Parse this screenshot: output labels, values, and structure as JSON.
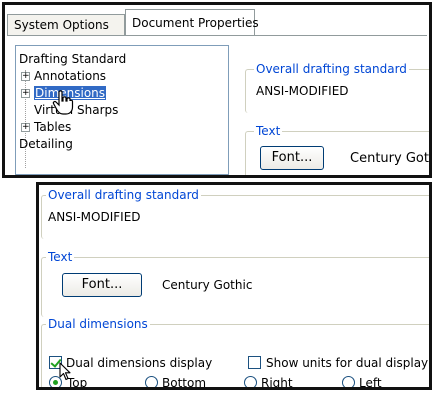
{
  "tabs": {
    "system_options": "System Options",
    "document_properties": "Document Properties"
  },
  "tree": {
    "items": [
      {
        "label": "Drafting Standard"
      },
      {
        "label": "Annotations"
      },
      {
        "label": "Dimensions"
      },
      {
        "label": "Virtual Sharps"
      },
      {
        "label": "Tables"
      },
      {
        "label": "Detailing"
      }
    ],
    "expander_symbol": "+"
  },
  "top_panel": {
    "drafting_group_label": "Overall drafting standard",
    "drafting_value": "ANSI-MODIFIED",
    "text_group_label": "Text",
    "font_button": "Font...",
    "font_name": "Century Gothic"
  },
  "bottom_panel": {
    "drafting_group_label": "Overall drafting standard",
    "drafting_value": "ANSI-MODIFIED",
    "text_group_label": "Text",
    "font_button": "Font...",
    "font_name": "Century Gothic",
    "dual_group_label": "Dual dimensions",
    "dual_display_label": "Dual dimensions display",
    "dual_display_checked": true,
    "show_units_label": "Show units for dual display",
    "show_units_checked": false,
    "position_options": [
      "Top",
      "Bottom",
      "Right",
      "Left"
    ],
    "position_selected": "Top"
  },
  "colors": {
    "group_label": "#0046d5",
    "selection": "#316ac5",
    "check": "#21a121"
  },
  "icons": {
    "pointer": "hand-pointer-icon",
    "arrow": "arrow-cursor-icon"
  }
}
